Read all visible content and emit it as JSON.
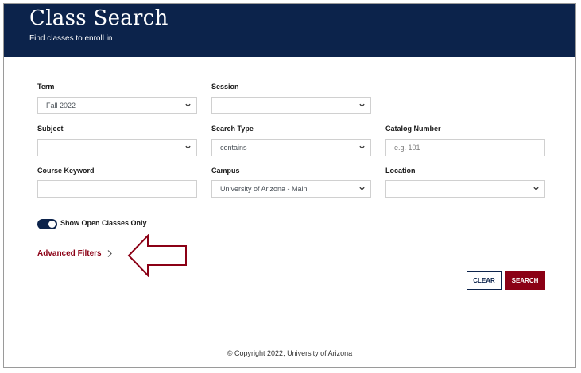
{
  "header": {
    "title": "Class Search",
    "subtitle": "Find classes to enroll in",
    "background_color": "#0c234b"
  },
  "form": {
    "term": {
      "label": "Term",
      "value": "Fall 2022"
    },
    "session": {
      "label": "Session",
      "value": ""
    },
    "subject": {
      "label": "Subject",
      "value": ""
    },
    "search_type": {
      "label": "Search Type",
      "value": "contains"
    },
    "catalog_number": {
      "label": "Catalog Number",
      "value": "",
      "placeholder": "e.g. 101"
    },
    "course_keyword": {
      "label": "Course Keyword",
      "value": ""
    },
    "campus": {
      "label": "Campus",
      "value": "University of Arizona - Main"
    },
    "location": {
      "label": "Location",
      "value": ""
    }
  },
  "toggle": {
    "label": "Show Open Classes Only",
    "checked": true
  },
  "advanced_filters": {
    "label": "Advanced Filters",
    "icon": "chevron-right-icon"
  },
  "annotation": {
    "icon": "left-arrow-callout",
    "color": "#8b0015"
  },
  "buttons": {
    "clear": "CLEAR",
    "search": "SEARCH",
    "accent_color": "#8b0015"
  },
  "footer": {
    "copyright": "© Copyright 2022, University of Arizona"
  }
}
